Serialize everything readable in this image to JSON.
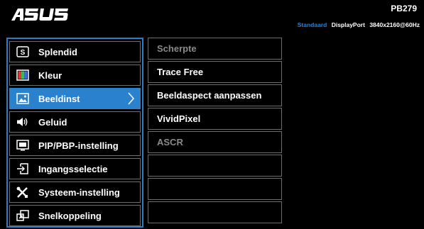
{
  "header": {
    "logo": "ASUS",
    "model": "PB279",
    "status": {
      "mode": "Standaard",
      "input": "DisplayPort",
      "resolution": "3840x2160@60Hz"
    }
  },
  "menu": {
    "items": [
      {
        "label": "Splendid",
        "icon": "splendid-icon"
      },
      {
        "label": "Kleur",
        "icon": "color-icon"
      },
      {
        "label": "Beeldinst",
        "icon": "image-icon",
        "selected": true
      },
      {
        "label": "Geluid",
        "icon": "speaker-icon"
      },
      {
        "label": "PIP/PBP-instelling",
        "icon": "pip-icon"
      },
      {
        "label": "Ingangsselectie",
        "icon": "input-select-icon"
      },
      {
        "label": "Systeem-instelling",
        "icon": "tools-icon"
      },
      {
        "label": "Snelkoppeling",
        "icon": "shortcut-icon"
      }
    ]
  },
  "submenu": {
    "items": [
      {
        "label": "Scherpte",
        "disabled": true
      },
      {
        "label": "Trace Free",
        "disabled": false
      },
      {
        "label": "Beeldaspect aanpassen",
        "disabled": false
      },
      {
        "label": "VividPixel",
        "disabled": false
      },
      {
        "label": "ASCR",
        "disabled": true
      },
      {
        "label": ""
      },
      {
        "label": ""
      },
      {
        "label": ""
      }
    ]
  },
  "colors": {
    "accent": "#2a82cf",
    "background": "#000000",
    "disabled_text": "#8a8a8a",
    "mode_text": "#2f7fd0"
  }
}
